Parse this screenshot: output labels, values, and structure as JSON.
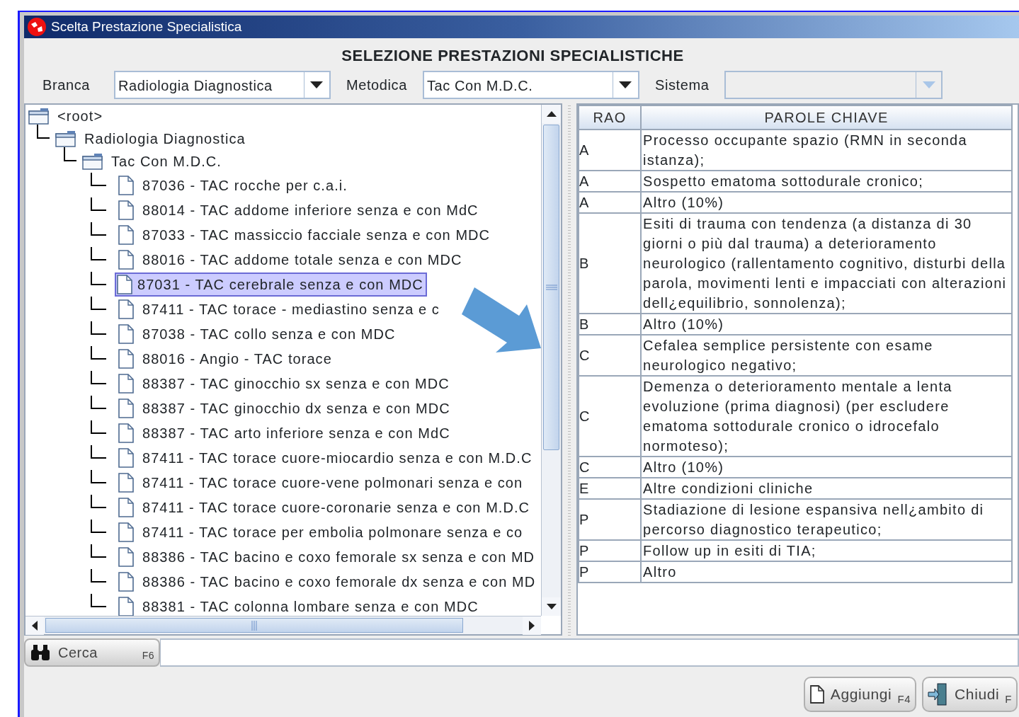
{
  "window": {
    "title": "Scelta Prestazione Specialistica"
  },
  "heading": "SELEZIONE PRESTAZIONI SPECIALISTICHE",
  "filters": [
    {
      "label": "Branca",
      "value": "Radiologia Diagnostica",
      "disabled": false
    },
    {
      "label": "Metodica",
      "value": "Tac Con M.D.C.",
      "disabled": false
    },
    {
      "label": "Sistema",
      "disabled": true
    }
  ],
  "tree": {
    "label": "<root>",
    "children": [
      {
        "label": "Radiologia Diagnostica",
        "children": [
          {
            "label": "Tac Con M.D.C.",
            "children": [
              {
                "label": "87036 - TAC  rocche per c.a.i.",
                "selected": false
              },
              {
                "label": "88014 - TAC addome inferiore senza e con MdC",
                "selected": false
              },
              {
                "label": "87033 - TAC massiccio facciale senza e con MDC",
                "selected": false
              },
              {
                "label": "88016 - TAC addome totale senza e con MDC",
                "selected": false
              },
              {
                "label": "87031 - TAC cerebrale senza e con MDC",
                "selected": true
              },
              {
                "label": "87411 - TAC torace - mediastino senza e c",
                "selected": false
              },
              {
                "label": "87038 - TAC collo senza e con MDC",
                "selected": false
              },
              {
                "label": "88016 - Angio - TAC torace",
                "selected": false
              },
              {
                "label": "88387 - TAC ginocchio sx senza e con MDC",
                "selected": false
              },
              {
                "label": "88387 - TAC ginocchio dx senza e con MDC",
                "selected": false
              },
              {
                "label": "88387 - TAC arto inferiore senza e con MdC",
                "selected": false
              },
              {
                "label": "87411 - TAC torace cuore-miocardio senza e con M.D.C",
                "selected": false
              },
              {
                "label": "87411 - TAC torace cuore-vene polmonari senza e con",
                "selected": false
              },
              {
                "label": "87411 - TAC torace cuore-coronarie senza e con M.D.C",
                "selected": false
              },
              {
                "label": "87411 - TAC torace per embolia polmonare senza e co",
                "selected": false
              },
              {
                "label": "88386 - TAC bacino e coxo femorale sx senza e con MD",
                "selected": false
              },
              {
                "label": "88386 - TAC bacino e coxo femorale dx senza e con MD",
                "selected": false
              },
              {
                "label": "88381 - TAC colonna lombare senza e con MDC",
                "selected": false
              }
            ]
          }
        ]
      }
    ]
  },
  "table": {
    "columns": [
      "RAO",
      "PAROLE CHIAVE"
    ],
    "rows": [
      {
        "rao": "A",
        "text": "Processo occupante spazio (RMN in seconda istanza);"
      },
      {
        "rao": "A",
        "text": "Sospetto ematoma sottodurale cronico;"
      },
      {
        "rao": "A",
        "text": "Altro (10%)"
      },
      {
        "rao": "B",
        "text": "Esiti di trauma con tendenza (a distanza di 30 giorni o più dal trauma) a deterioramento neurologico (rallentamento cognitivo, disturbi della parola, movimenti lenti e impacciati con alterazioni dell¿equilibrio, sonnolenza);"
      },
      {
        "rao": "B",
        "text": "Altro (10%)"
      },
      {
        "rao": "C",
        "text": "Cefalea semplice persistente con esame neurologico negativo;"
      },
      {
        "rao": "C",
        "text": "Demenza o deterioramento mentale a lenta evoluzione (prima diagnosi) (per escludere ematoma sottodurale cronico o idrocefalo normoteso);"
      },
      {
        "rao": "C",
        "text": "Altro (10%)"
      },
      {
        "rao": "E",
        "text": "Altre condizioni cliniche"
      },
      {
        "rao": "P",
        "text": "Stadiazione di lesione espansiva nell¿ambito di percorso diagnostico terapeutico;"
      },
      {
        "rao": "P",
        "text": "Follow up in esiti di TIA;"
      },
      {
        "rao": "P",
        "text": "Altro"
      }
    ]
  },
  "search": {
    "button": "Cerca",
    "shortcut": "F6"
  },
  "buttons": [
    {
      "kind": "add",
      "label": "Aggiungi",
      "shortcut": "F4"
    },
    {
      "kind": "close",
      "label": "Chiudi",
      "shortcut": "F"
    }
  ]
}
